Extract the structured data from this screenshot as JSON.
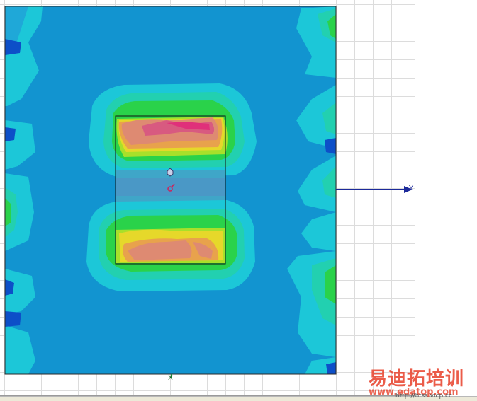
{
  "viewport": {
    "axes": {
      "y_label": "Y",
      "x_label": "X"
    },
    "colors": {
      "background_field": "#1294d0",
      "dark_blue": "#0d4fc8",
      "cyan": "#1cc7d8",
      "teal": "#22d0b0",
      "green": "#2ad24a",
      "lime": "#a8e02a",
      "yellow": "#e6d82a",
      "orange": "#e8a24c",
      "salmon": "#de8a72",
      "pink": "#d85a80",
      "magenta": "#e0307a",
      "axis_blue": "#1c2a9a"
    }
  },
  "watermark": {
    "text_cn": "易迪拓培训",
    "url": "www.edatop.com",
    "sub": "http://hfss.vicp.cc"
  }
}
